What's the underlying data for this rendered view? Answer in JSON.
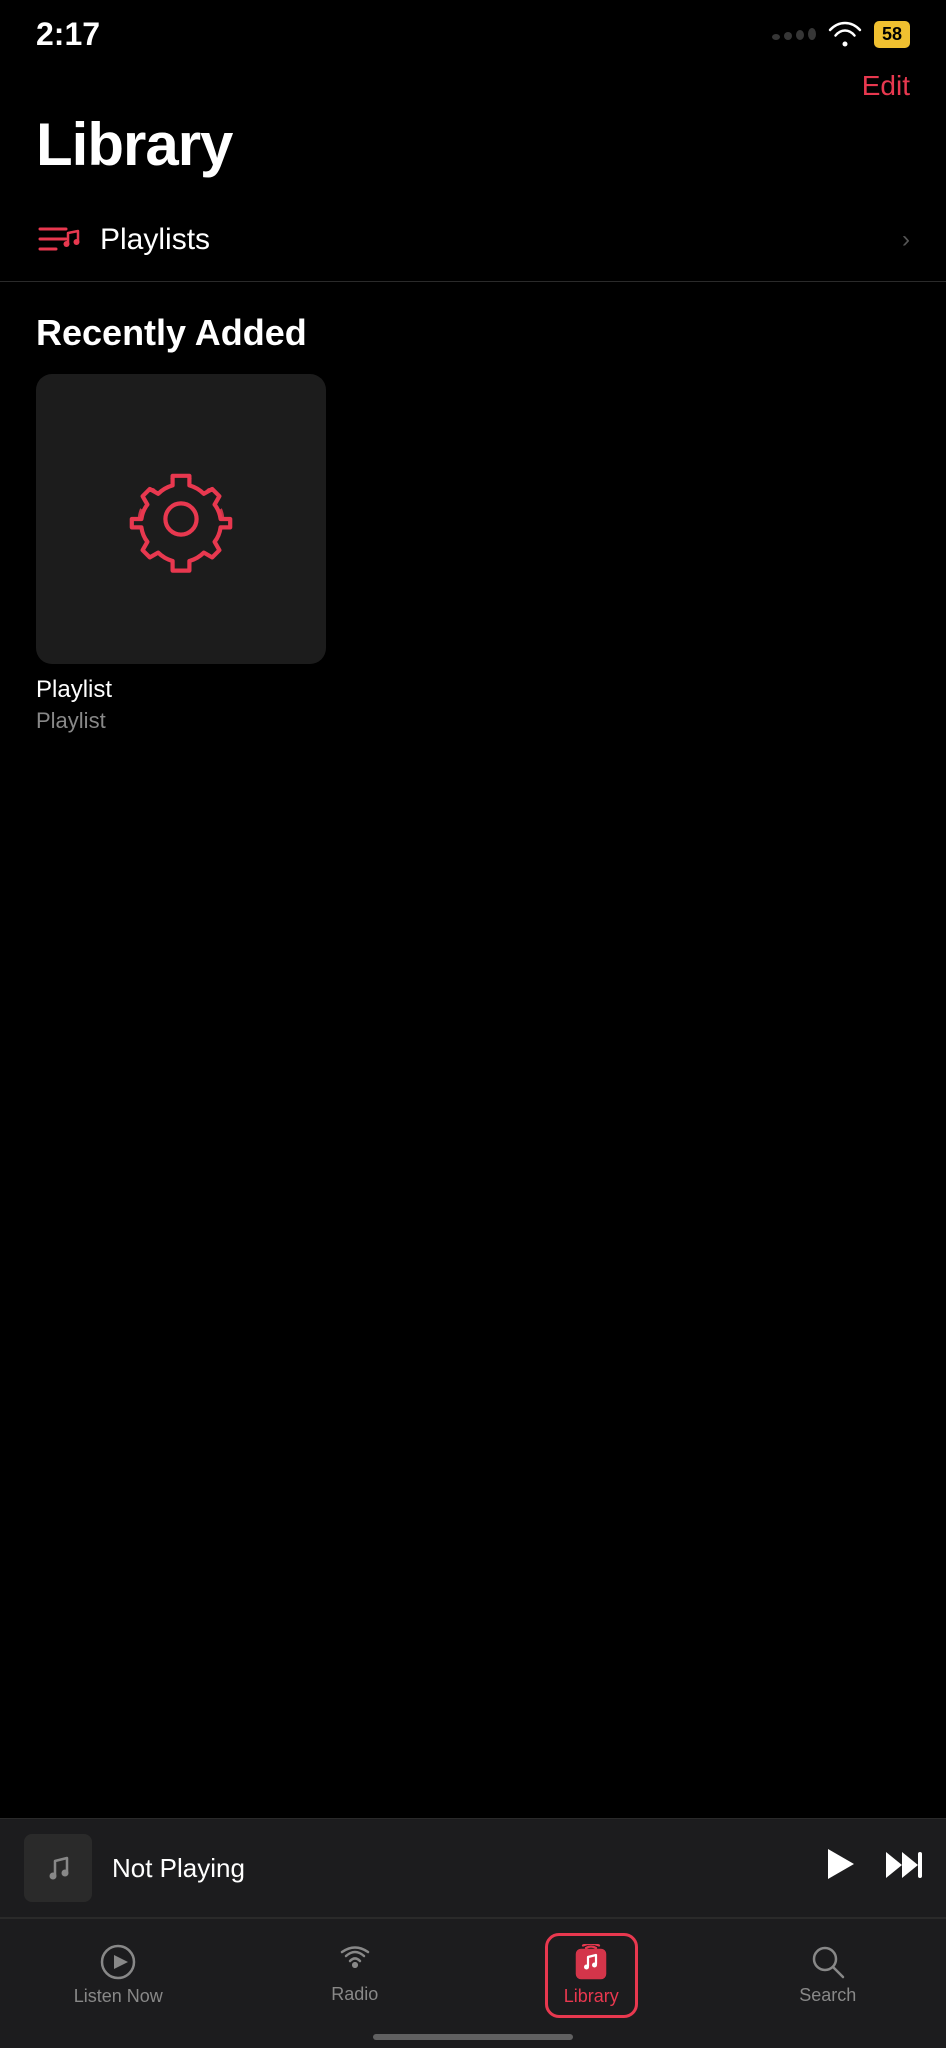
{
  "statusBar": {
    "time": "2:17",
    "battery": "58"
  },
  "header": {
    "editLabel": "Edit"
  },
  "page": {
    "title": "Library"
  },
  "sections": {
    "playlists": {
      "label": "Playlists"
    },
    "recentlyAdded": {
      "label": "Recently Added"
    }
  },
  "albums": [
    {
      "name": "Playlist",
      "subtitle": "Playlist"
    }
  ],
  "miniPlayer": {
    "title": "Not Playing"
  },
  "tabBar": {
    "items": [
      {
        "label": "Listen Now",
        "icon": "play-circle"
      },
      {
        "label": "Radio",
        "icon": "radio"
      },
      {
        "label": "Library",
        "icon": "library",
        "active": true
      },
      {
        "label": "Search",
        "icon": "search"
      }
    ]
  }
}
